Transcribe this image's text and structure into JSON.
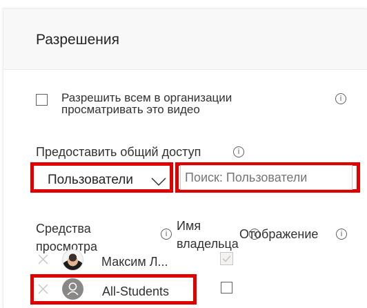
{
  "panel": {
    "title": "Разрешения"
  },
  "org_permission": {
    "checked": false,
    "label_line1": "Разрешить всем в организации",
    "label_line2": "просматривать это видео"
  },
  "share": {
    "label": "Предоставить общий доступ",
    "dropdown_value": "Пользователи",
    "search_placeholder": "Поиск: Пользователи"
  },
  "table": {
    "col_viewers_line1": "Средства",
    "col_viewers_line2": "просмотра",
    "col_owner_line1": "Имя",
    "col_owner_line2": "владельца",
    "col_display": "Отображение",
    "rows": [
      {
        "name": "Максим Л...",
        "avatar": "photo",
        "owner_checked": true,
        "owner_disabled": true
      },
      {
        "name": "All-Students",
        "avatar": "generic-person-icon",
        "owner_checked": false,
        "owner_disabled": false
      }
    ]
  },
  "colors": {
    "highlight": "#e00000",
    "header_bg": "#f8f8f8"
  }
}
